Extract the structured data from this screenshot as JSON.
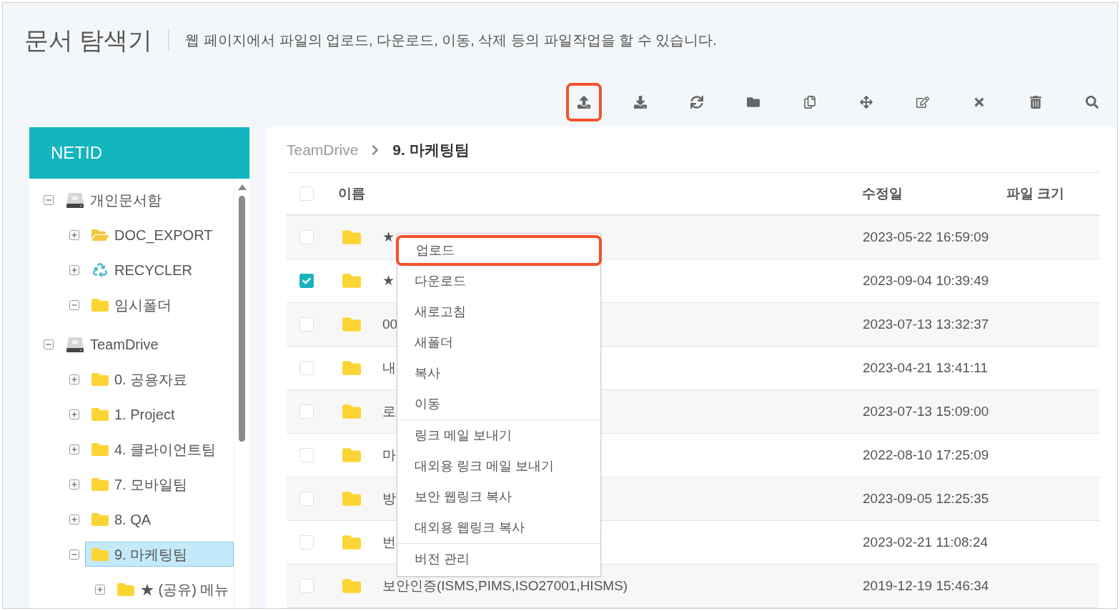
{
  "header": {
    "title": "문서 탐색기",
    "description": "웹 페이지에서 파일의 업로드, 다운로드, 이동, 삭제 등의 파일작업을 할 수 있습니다."
  },
  "toolbar": [
    {
      "kind": "upload",
      "highlighted": true
    },
    {
      "kind": "download",
      "highlighted": false
    },
    {
      "kind": "refresh",
      "highlighted": false
    },
    {
      "kind": "folder",
      "highlighted": false
    },
    {
      "kind": "copy",
      "highlighted": false
    },
    {
      "kind": "move",
      "highlighted": false
    },
    {
      "kind": "edit",
      "highlighted": false
    },
    {
      "kind": "close",
      "highlighted": false
    },
    {
      "kind": "delete",
      "highlighted": false
    },
    {
      "kind": "search",
      "highlighted": false
    }
  ],
  "sidebar": {
    "title": "NETID",
    "tree": [
      {
        "label": "개인문서함",
        "kind": "drive",
        "expanded": true,
        "selected": false,
        "children": [
          {
            "label": "DOC_EXPORT",
            "kind": "export",
            "expanded": false,
            "selected": false
          },
          {
            "label": "RECYCLER",
            "kind": "recycler",
            "expanded": false,
            "selected": false
          },
          {
            "label": "임시폴더",
            "kind": "folder",
            "expanded": true,
            "selected": false
          }
        ]
      },
      {
        "label": "TeamDrive",
        "kind": "drive",
        "expanded": true,
        "selected": false,
        "children": [
          {
            "label": "0. 공용자료",
            "kind": "folder",
            "expanded": false,
            "selected": false
          },
          {
            "label": "1. Project",
            "kind": "folder",
            "expanded": false,
            "selected": false
          },
          {
            "label": "4. 클라이언트팀",
            "kind": "folder",
            "expanded": false,
            "selected": false
          },
          {
            "label": "7. 모바일팀",
            "kind": "folder",
            "expanded": false,
            "selected": false
          },
          {
            "label": "8. QA",
            "kind": "folder",
            "expanded": false,
            "selected": false
          },
          {
            "label": "9. 마케팅팀",
            "kind": "folder",
            "expanded": true,
            "selected": true,
            "children": [
              {
                "label": "★ (공유) 메뉴",
                "kind": "folder",
                "expanded": false,
                "selected": false
              }
            ]
          }
        ]
      }
    ]
  },
  "breadcrumb": [
    "TeamDrive",
    "9. 마케팅팀"
  ],
  "table": {
    "columns": [
      "이름",
      "수정일",
      "파일 크기"
    ],
    "all_checked": false,
    "rows": [
      {
        "name": "★",
        "modified": "2023-05-22 16:59:09",
        "checked": false
      },
      {
        "name": "★",
        "modified": "2023-09-04 10:39:49",
        "checked": true
      },
      {
        "name": "00",
        "modified": "2023-07-13 13:32:37",
        "checked": false
      },
      {
        "name": "내",
        "modified": "2023-04-21 13:41:11",
        "checked": false
      },
      {
        "name": "로",
        "modified": "2023-07-13 15:09:00",
        "checked": false
      },
      {
        "name": "마",
        "modified": "2022-08-10 17:25:09",
        "checked": false
      },
      {
        "name": "방",
        "modified": "2023-09-05 12:25:35",
        "checked": false
      },
      {
        "name": "번",
        "modified": "2023-02-21 11:08:24",
        "checked": false
      },
      {
        "name": "보안인증(ISMS,PIMS,ISO27001,HISMS)",
        "modified": "2019-12-19 15:46:34",
        "checked": false
      }
    ]
  },
  "context_menu": [
    {
      "label": "업로드",
      "highlighted": true,
      "divider_after": false
    },
    {
      "label": "다운로드",
      "highlighted": false,
      "divider_after": false
    },
    {
      "label": "새로고침",
      "highlighted": false,
      "divider_after": false
    },
    {
      "label": "새폴더",
      "highlighted": false,
      "divider_after": false
    },
    {
      "label": "복사",
      "highlighted": false,
      "divider_after": false
    },
    {
      "label": "이동",
      "highlighted": false,
      "divider_after": true
    },
    {
      "label": "링크 메일 보내기",
      "highlighted": false,
      "divider_after": false
    },
    {
      "label": "대외용 링크 메일 보내기",
      "highlighted": false,
      "divider_after": false
    },
    {
      "label": "보안 웹링크 복사",
      "highlighted": false,
      "divider_after": false
    },
    {
      "label": "대외용 웹링크 복사",
      "highlighted": false,
      "divider_after": true
    },
    {
      "label": "버전 관리",
      "highlighted": false,
      "divider_after": false
    }
  ]
}
